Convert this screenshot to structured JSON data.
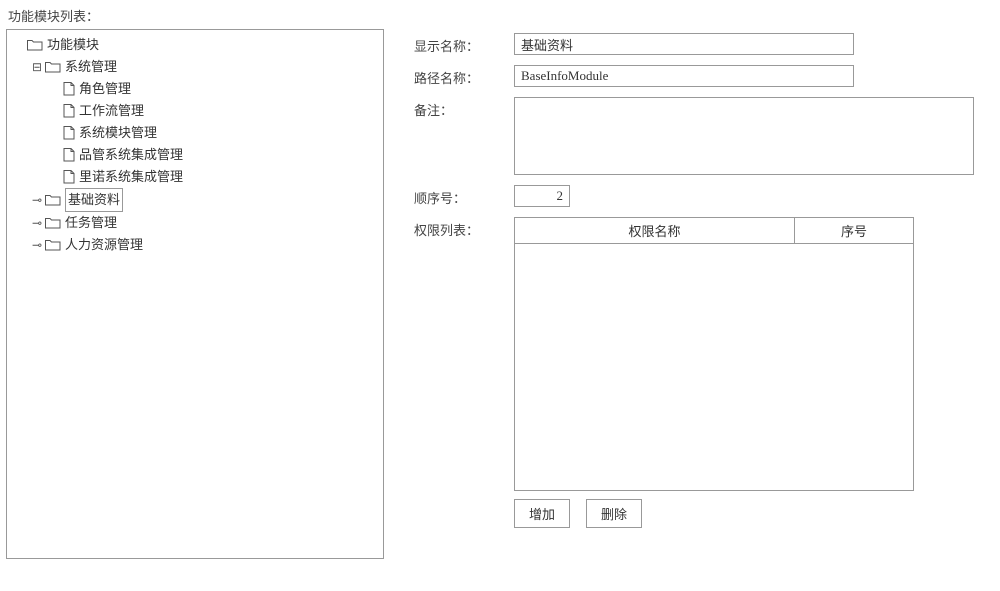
{
  "page_title": "功能模块列表：",
  "tree": {
    "root_label": "功能模块",
    "system_mgmt": {
      "label": "系统管理",
      "children": [
        "角色管理",
        "工作流管理",
        "系统模块管理",
        "品管系统集成管理",
        "里诺系统集成管理"
      ]
    },
    "base_info": "基础资料",
    "task_mgmt": "任务管理",
    "hr_mgmt": "人力资源管理"
  },
  "form": {
    "labels": {
      "display_name": "显示名称：",
      "path_name": "路径名称：",
      "remark": "备注：",
      "order": "顺序号：",
      "perm_list": "权限列表："
    },
    "values": {
      "display_name": "基础资料",
      "path_name": "BaseInfoModule",
      "remark": "",
      "order": "2"
    },
    "perm_table": {
      "headers": {
        "name": "权限名称",
        "seq": "序号"
      }
    },
    "buttons": {
      "add": "增加",
      "delete": "删除"
    }
  },
  "icons": {
    "folder": "folder",
    "file": "file"
  }
}
